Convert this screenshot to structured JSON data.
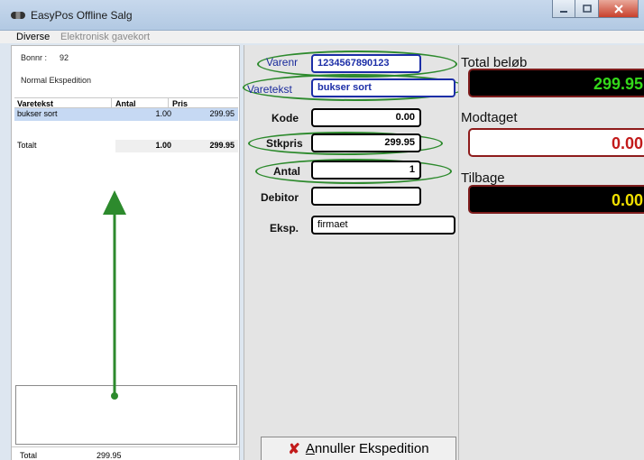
{
  "window": {
    "title": "EasyPos Offline Salg"
  },
  "menu": {
    "diverse": "Diverse",
    "gavekort": "Elektronisk gavekort"
  },
  "left": {
    "bon_label": "Bonnr :",
    "bon_number": "92",
    "expedition_type": "Normal Ekspedition",
    "columns": [
      "Varetekst",
      "Antal",
      "Pris"
    ],
    "rows": [
      {
        "text": "bukser sort",
        "antal": "1.00",
        "pris": "299.95"
      }
    ],
    "totalt_label": "Totalt",
    "totalt_antal": "1.00",
    "totalt_pris": "299.95",
    "footer_label": "Total",
    "footer_value": "299.95"
  },
  "form": {
    "varenr_label": "Varenr",
    "varenr_value": "1234567890123",
    "varetekst_label": "Varetekst",
    "varetekst_value": "bukser sort",
    "kode_label": "Kode",
    "kode_value": "0.00",
    "stkpris_label": "Stkpris",
    "stkpris_value": "299.95",
    "antal_label": "Antal",
    "antal_value": "1",
    "debitor_label": "Debitor",
    "debitor_value": "",
    "eksp_label": "Eksp.",
    "eksp_value": "firmaet",
    "cancel_underlined": "A",
    "cancel_rest": "nnuller Ekspedition"
  },
  "summary": {
    "total_label": "Total beløb",
    "total_value": "299.95",
    "received_label": "Modtaget",
    "received_value": "0.00",
    "back_label": "Tilbage",
    "back_value": "0.00"
  },
  "colors": {
    "annotation": "#2d8a2d",
    "total_display": "#34d81a",
    "received_display": "#c21b1b",
    "back_display": "#f0e000"
  }
}
